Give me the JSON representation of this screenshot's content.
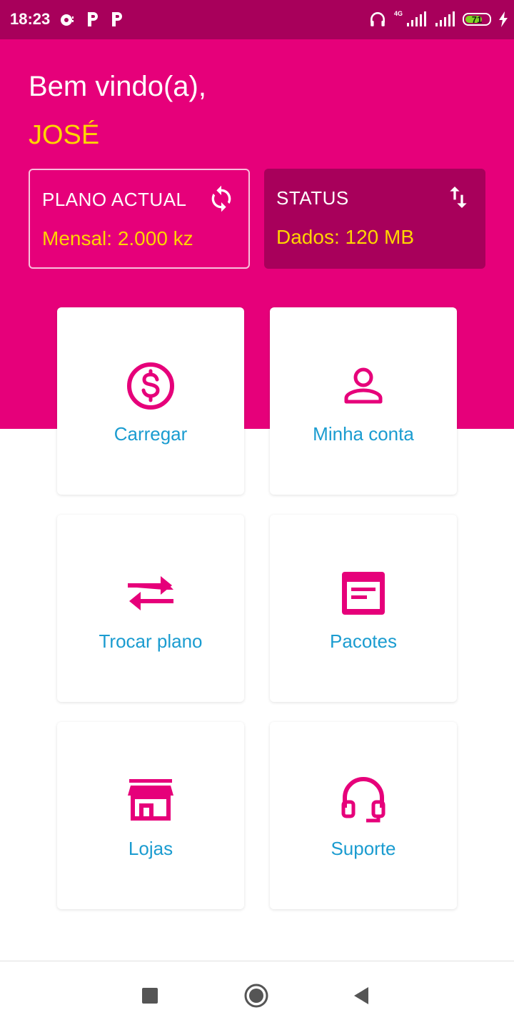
{
  "status_bar": {
    "time": "18:23",
    "network_label": "4G",
    "battery_level": 71,
    "battery_text": "71",
    "icons": [
      "notification-icon",
      "parking-p-icon",
      "parking-p-icon",
      "headphones-icon",
      "signal-icon",
      "signal-icon",
      "battery-icon",
      "charging-icon"
    ]
  },
  "header": {
    "welcome": "Bem vindo(a),",
    "user_name": "JOSÉ"
  },
  "plan_card": {
    "title": "PLANO ACTUAL",
    "value": "Mensal: 2.000 kz",
    "icon": "refresh-icon"
  },
  "status_card": {
    "title": "STATUS",
    "value": "Dados: 120 MB",
    "icon": "data-transfer-icon"
  },
  "menu": {
    "items": [
      {
        "label": "Carregar",
        "icon": "dollar-circle-icon"
      },
      {
        "label": "Minha conta",
        "icon": "user-icon"
      },
      {
        "label": "Trocar plano",
        "icon": "swap-icon"
      },
      {
        "label": "Pacotes",
        "icon": "package-icon"
      },
      {
        "label": "Lojas",
        "icon": "store-icon"
      },
      {
        "label": "Suporte",
        "icon": "headset-icon"
      }
    ]
  },
  "nav_bar": {
    "buttons": [
      "recents-icon",
      "home-icon",
      "back-icon"
    ]
  },
  "colors": {
    "brand": "#e6007a",
    "brand_dark": "#a8005b",
    "highlight": "#ffd400",
    "link": "#1b9cd0"
  }
}
